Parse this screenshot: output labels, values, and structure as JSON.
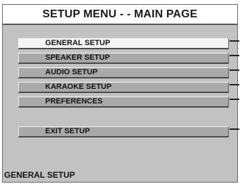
{
  "menu": {
    "title": "SETUP MENU - - MAIN PAGE",
    "items": [
      {
        "label": "GENERAL SETUP",
        "selected": true
      },
      {
        "label": "SPEAKER SETUP",
        "selected": false
      },
      {
        "label": "AUDIO SETUP",
        "selected": false
      },
      {
        "label": "KARAOKE SETUP",
        "selected": false
      },
      {
        "label": "PREFERENCES",
        "selected": false
      }
    ],
    "exit_label": "EXIT SETUP"
  },
  "status": {
    "text": "GENERAL SETUP"
  },
  "colors": {
    "background": "#c2c2c2",
    "title_background": "#ffffff",
    "item_background": "#a9a9a9",
    "selected_background": "#f4f4f4"
  }
}
